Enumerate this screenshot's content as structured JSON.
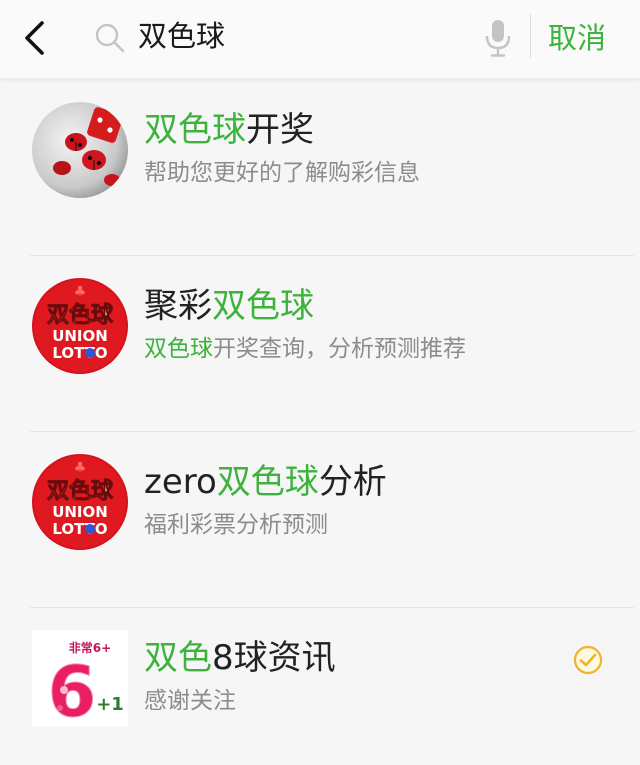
{
  "search": {
    "query": "双色球",
    "cancel_label": "取消"
  },
  "colors": {
    "accent": "#3db23d",
    "title_text": "#222222",
    "subtitle_text": "#8c8c8c",
    "verified": "#f0b429"
  },
  "results": [
    {
      "avatar": "ladybug-dice-avatar",
      "title_hl_1": "双色球",
      "title_rest_1": "开奖",
      "subtitle": "帮助您更好的了解购彩信息"
    },
    {
      "avatar": "union-lotto-logo",
      "avatar_text_top": "双色球",
      "avatar_text_mid": "UNION",
      "avatar_text_bot": "LOTTO",
      "title_pre": "聚彩",
      "title_hl": "双色球",
      "subtitle_hl": "双色球",
      "subtitle_rest": "开奖查询，分析预测推荐"
    },
    {
      "avatar": "union-lotto-logo",
      "avatar_text_top": "双色球",
      "avatar_text_mid": "UNION",
      "avatar_text_bot": "LOTTO",
      "title_pre": "zero",
      "title_hl": "双色球",
      "title_post": "分析",
      "subtitle": "福利彩票分析预测"
    },
    {
      "avatar": "six-plus-one-logo",
      "avatar_text_small": "非常6+",
      "avatar_text_big": "6",
      "avatar_text_plus": "+1",
      "title_hl": "双色",
      "title_post": "8球资讯",
      "subtitle": "感谢关注",
      "verified": true
    }
  ]
}
